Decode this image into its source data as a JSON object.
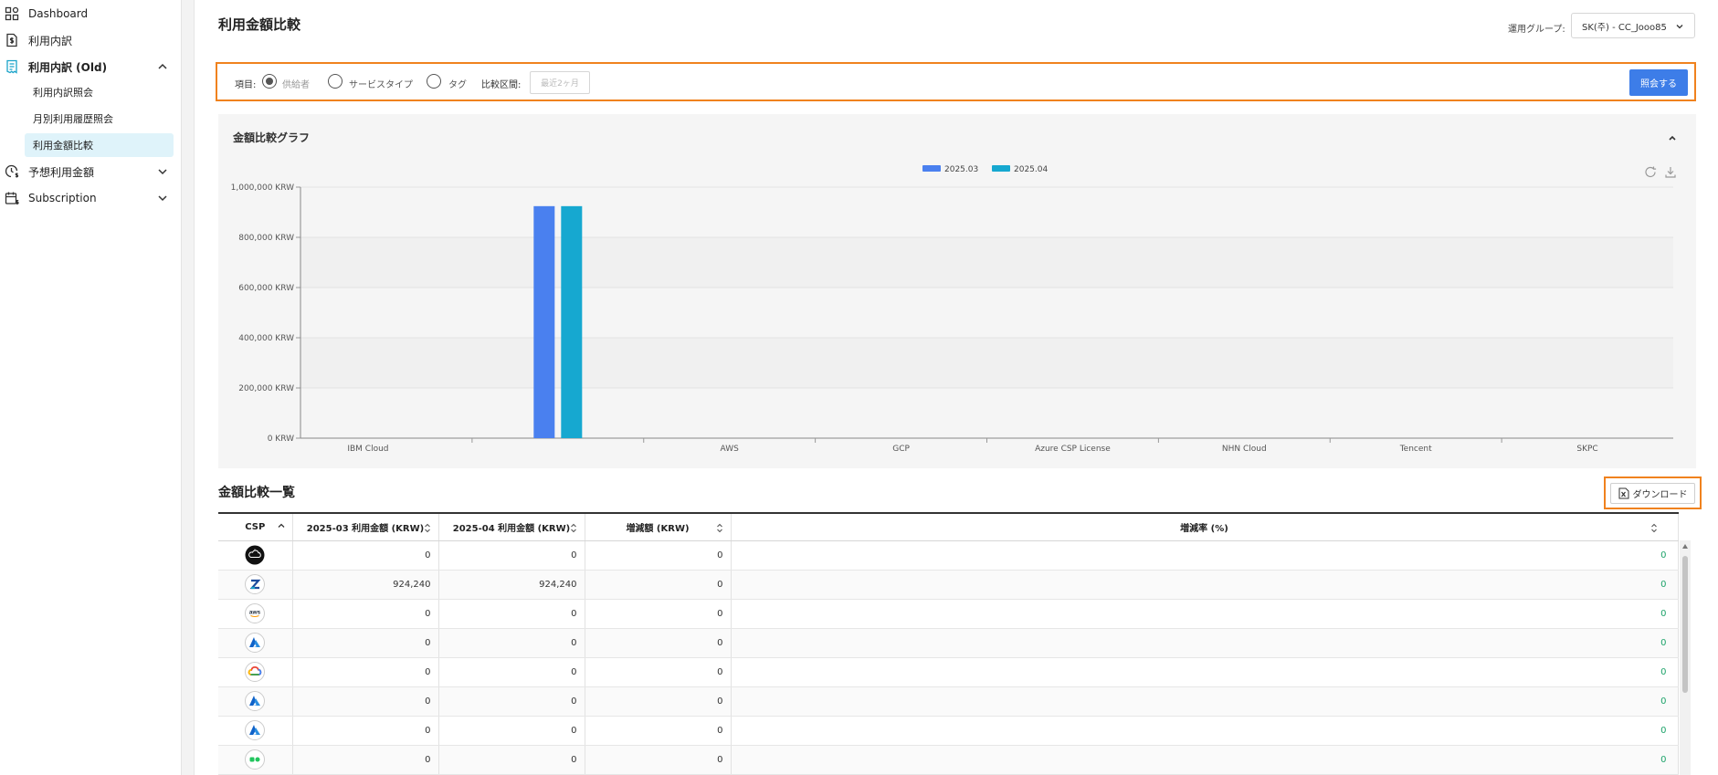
{
  "sidebar": {
    "items": [
      {
        "label": "Dashboard",
        "icon": "grid-icon"
      },
      {
        "label": "利用内訳",
        "icon": "dollar-doc-icon"
      },
      {
        "label": "利用内訳 (Old)",
        "icon": "receipt-icon"
      },
      {
        "label": "予想利用金額",
        "icon": "clock-dollar-icon"
      },
      {
        "label": "Subscription",
        "icon": "calendar-dollar-icon"
      }
    ],
    "subitems": [
      "利用内訳照会",
      "月別利用履歴照会",
      "利用金額比較"
    ],
    "accent": "#1aa3c9"
  },
  "header": {
    "title": "利用金額比較",
    "group_label": "運用グループ:",
    "group_value": "SK(주) - CC_Jooo85"
  },
  "filter": {
    "item_label": "項目:",
    "options": [
      "供給者",
      "サービスタイプ",
      "タグ"
    ],
    "period_label": "比較区間:",
    "period_placeholder": "最近2ヶ月",
    "search_button": "照会する"
  },
  "chart_panel": {
    "title": "金額比較グラフ"
  },
  "chart_data": {
    "type": "bar",
    "categories": [
      "IBM Cloud",
      "",
      "AWS",
      "GCP",
      "Azure CSP License",
      "NHN Cloud",
      "Tencent",
      "SKPC"
    ],
    "series": [
      {
        "name": "2025.03",
        "values": [
          0,
          924240,
          0,
          0,
          0,
          0,
          0,
          0
        ],
        "color": "#4a80ef"
      },
      {
        "name": "2025.04",
        "values": [
          0,
          924240,
          0,
          0,
          0,
          0,
          0,
          0
        ],
        "color": "#16a8d0"
      }
    ],
    "y_ticks": [
      "0 KRW",
      "200,000 KRW",
      "400,000 KRW",
      "600,000 KRW",
      "800,000 KRW",
      "1,000,000 KRW"
    ],
    "ylim": [
      0,
      1000000
    ],
    "legend": "top-center",
    "grid": true
  },
  "table": {
    "title": "金額比較一覧",
    "download_label": "ダウンロード",
    "columns": [
      "CSP",
      "2025-03 利用金額 (KRW)",
      "2025-04 利用金額 (KRW)",
      "増減額 (KRW)",
      "増減率 (%)"
    ],
    "rows": [
      {
        "logo": "ibm-cloud-logo",
        "v1": "0",
        "v2": "0",
        "diff": "0",
        "rate": "0"
      },
      {
        "logo": "z-logo",
        "v1": "924,240",
        "v2": "924,240",
        "diff": "0",
        "rate": "0"
      },
      {
        "logo": "aws-logo",
        "v1": "0",
        "v2": "0",
        "diff": "0",
        "rate": "0"
      },
      {
        "logo": "azure-logo",
        "v1": "0",
        "v2": "0",
        "diff": "0",
        "rate": "0"
      },
      {
        "logo": "gcp-logo",
        "v1": "0",
        "v2": "0",
        "diff": "0",
        "rate": "0"
      },
      {
        "logo": "azure-logo",
        "v1": "0",
        "v2": "0",
        "diff": "0",
        "rate": "0"
      },
      {
        "logo": "azure-logo",
        "v1": "0",
        "v2": "0",
        "diff": "0",
        "rate": "0"
      },
      {
        "logo": "nhn-cloud-logo",
        "v1": "0",
        "v2": "0",
        "diff": "0",
        "rate": "0"
      }
    ]
  }
}
